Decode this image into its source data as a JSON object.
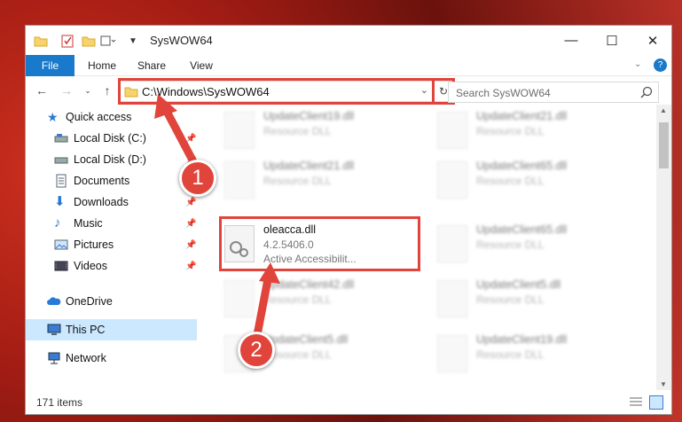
{
  "window": {
    "title": "SysWOW64"
  },
  "controls": {
    "minimize": "—",
    "maximize": "☐",
    "close": "✕"
  },
  "ribbon": {
    "tabs": [
      "File",
      "Home",
      "Share",
      "View"
    ]
  },
  "address": {
    "path": "C:\\Windows\\SysWOW64"
  },
  "search": {
    "placeholder": "Search SysWOW64"
  },
  "sidebar": {
    "items": [
      {
        "label": "Quick access",
        "icon": "star-icon",
        "pinned": false
      },
      {
        "label": "Local Disk (C:)",
        "icon": "drive-icon",
        "pinned": true
      },
      {
        "label": "Local Disk (D:)",
        "icon": "drive-icon",
        "pinned": true
      },
      {
        "label": "Documents",
        "icon": "documents-icon",
        "pinned": true
      },
      {
        "label": "Downloads",
        "icon": "download-icon",
        "pinned": true
      },
      {
        "label": "Music",
        "icon": "music-icon",
        "pinned": true
      },
      {
        "label": "Pictures",
        "icon": "pictures-icon",
        "pinned": true
      },
      {
        "label": "Videos",
        "icon": "videos-icon",
        "pinned": true
      },
      {
        "label": "OneDrive",
        "icon": "cloud-icon",
        "pinned": false
      },
      {
        "label": "This PC",
        "icon": "pc-icon",
        "pinned": false,
        "selected": true
      },
      {
        "label": "Network",
        "icon": "network-icon",
        "pinned": false
      }
    ]
  },
  "files": [
    {
      "name": "UpdateClient19.dll",
      "type": "Resource DLL",
      "blurred": true
    },
    {
      "name": "UpdateClient21.dll",
      "type": "Resource DLL",
      "blurred": true
    },
    {
      "name": "UpdateClient21.dll",
      "type": "Resource DLL",
      "blurred": true
    },
    {
      "name": "UpdateClient65.dll",
      "type": "Resource DLL",
      "blurred": true
    },
    {
      "name": "oleacca.dll",
      "version": "4.2.5406.0",
      "description": "Active Accessibilit...",
      "blurred": false
    },
    {
      "name": "UpdateClient65.dll",
      "type": "Resource DLL",
      "blurred": true
    },
    {
      "name": "UpdateClient42.dll",
      "type": "Resource DLL",
      "blurred": true
    },
    {
      "name": "UpdateClient5.dll",
      "type": "Resource DLL",
      "blurred": true
    },
    {
      "name": "UpdateClient5.dll",
      "type": "Resource DLL",
      "blurred": true
    },
    {
      "name": "UpdateClient19.dll",
      "type": "Resource DLL",
      "blurred": true
    }
  ],
  "status": {
    "count": "171 items"
  },
  "callouts": [
    "1",
    "2"
  ],
  "colors": {
    "accent": "#1979ca",
    "highlight": "#e0443a",
    "selected": "#cce8ff"
  }
}
